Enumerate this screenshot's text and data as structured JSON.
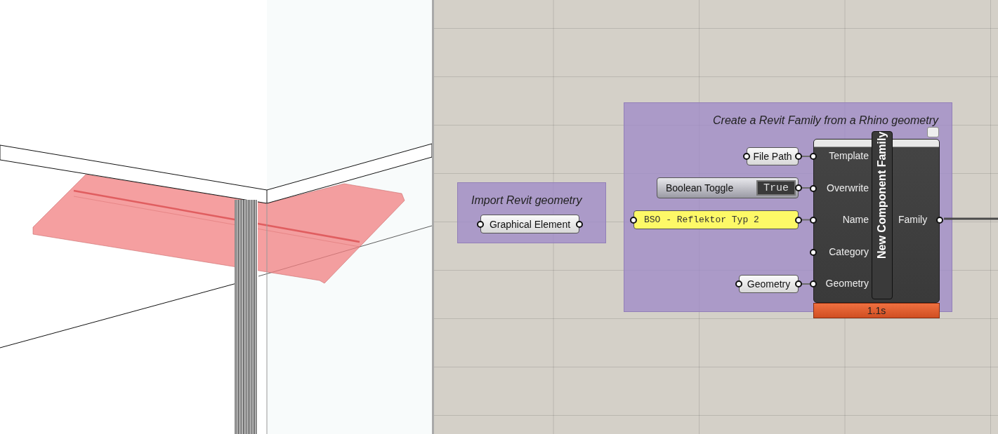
{
  "groups": [
    {
      "title": "Import Revit geometry",
      "nodes": [
        {
          "kind": "param",
          "label": "Graphical Element"
        }
      ]
    },
    {
      "title": "Create a Revit Family from a Rhino geometry",
      "nodes": [
        {
          "kind": "param",
          "label": "File Path"
        },
        {
          "kind": "toggle",
          "label": "Boolean Toggle",
          "value": "True"
        },
        {
          "kind": "panel",
          "label": "BSO - Reflektor Typ 2"
        },
        {
          "kind": "param",
          "label": "Geometry"
        }
      ]
    }
  ],
  "component": {
    "name": "New Component Family",
    "inputs": [
      "Template",
      "Overwrite",
      "Name",
      "Category",
      "Geometry"
    ],
    "outputs": [
      "Family"
    ],
    "runtime": "1.1s"
  }
}
